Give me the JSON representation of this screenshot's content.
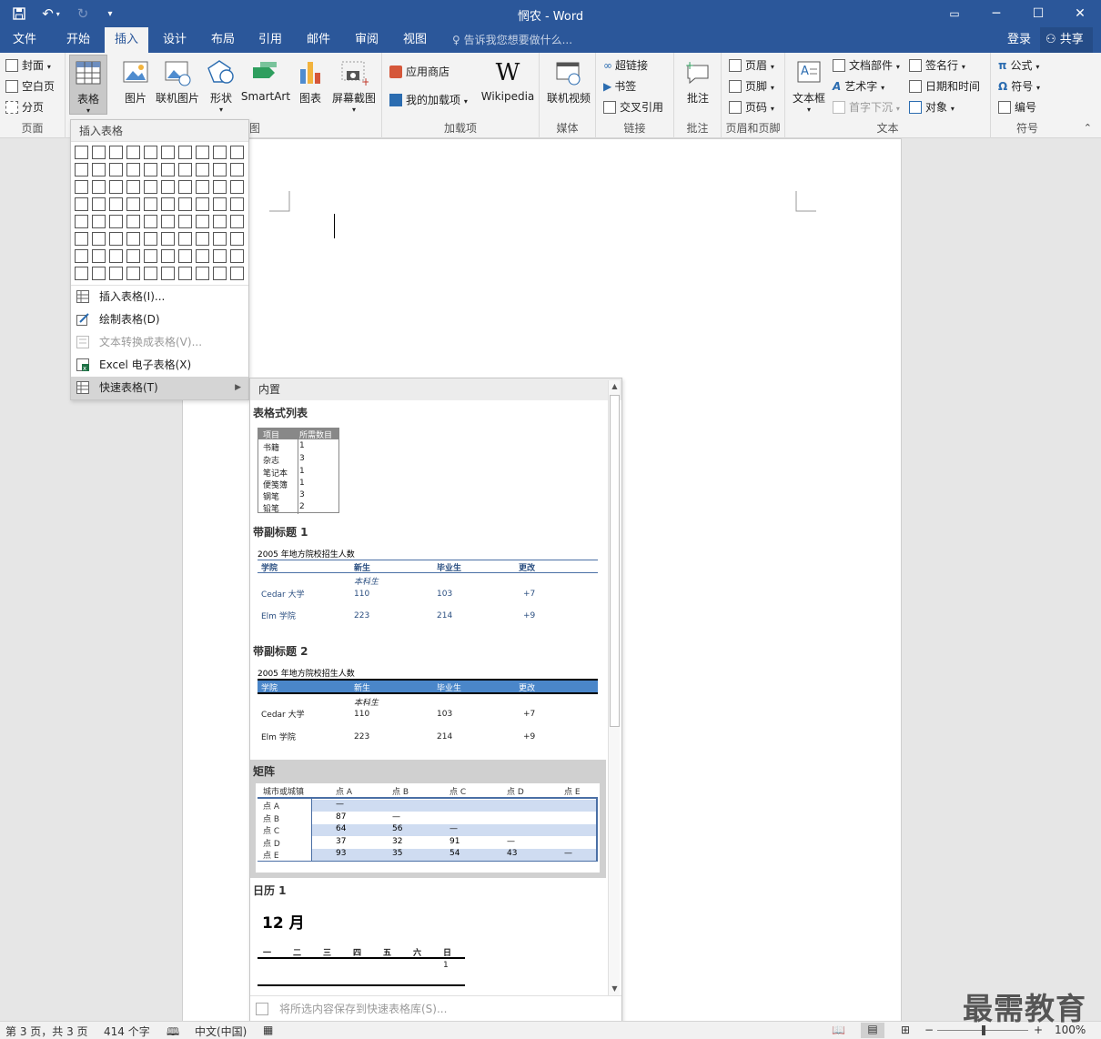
{
  "app": {
    "title": "惘农 - Word"
  },
  "window_controls": {
    "restore_ribbon": "▭",
    "minimize": "─",
    "maximize": "☐",
    "close": "✕"
  },
  "tabs": [
    {
      "label": "文件"
    },
    {
      "label": "开始"
    },
    {
      "label": "插入"
    },
    {
      "label": "设计"
    },
    {
      "label": "布局"
    },
    {
      "label": "引用"
    },
    {
      "label": "邮件"
    },
    {
      "label": "审阅"
    },
    {
      "label": "视图"
    }
  ],
  "tellme": "♀ 告诉我您想要做什么...",
  "account": {
    "login": "登录",
    "share": "共享"
  },
  "ribbon": {
    "pages": {
      "label": "页面",
      "cover": "封面",
      "blank": "空白页",
      "break": "分页"
    },
    "tables": {
      "label": "表格"
    },
    "illustrations": {
      "label": "图",
      "picture": "图片",
      "online_picture": "联机图片",
      "shapes": "形状",
      "smartart": "SmartArt",
      "chart": "图表",
      "screenshot": "屏幕截图"
    },
    "addins": {
      "label": "加载项",
      "store": "应用商店",
      "my_addins": "我的加载项",
      "wikipedia": "Wikipedia"
    },
    "media": {
      "label": "媒体",
      "video": "联机视频"
    },
    "links": {
      "label": "链接",
      "hyperlink": "超链接",
      "bookmark": "书签",
      "crossref": "交叉引用"
    },
    "comments": {
      "label": "批注",
      "comment": "批注"
    },
    "header_footer": {
      "label": "页眉和页脚",
      "header": "页眉",
      "footer": "页脚",
      "page_number": "页码"
    },
    "text": {
      "label": "文本",
      "textbox": "文本框",
      "quickparts": "文档部件",
      "wordart": "艺术字",
      "dropcap": "首字下沉",
      "signature": "签名行",
      "datetime": "日期和时间",
      "object": "对象"
    },
    "symbols": {
      "label": "符号",
      "equation": "公式",
      "symbol": "符号",
      "numbering": "编号"
    }
  },
  "table_menu": {
    "header": "插入表格",
    "items": [
      {
        "label": "插入表格(I)...",
        "disabled": false
      },
      {
        "label": "绘制表格(D)",
        "disabled": false
      },
      {
        "label": "文本转换成表格(V)...",
        "disabled": true
      },
      {
        "label": "Excel 电子表格(X)",
        "disabled": false
      },
      {
        "label": "快速表格(T)",
        "disabled": false
      }
    ]
  },
  "quick_tables": {
    "header": "内置",
    "footer": "将所选内容保存到快速表格库(S)...",
    "items": [
      {
        "title": "表格式列表",
        "head": [
          "项目",
          "所需数目"
        ],
        "rows": [
          [
            "书籍",
            "1"
          ],
          [
            "杂志",
            "3"
          ],
          [
            "笔记本",
            "1"
          ],
          [
            "便笺簿",
            "1"
          ],
          [
            "钢笔",
            "3"
          ],
          [
            "铅笔",
            "2"
          ]
        ]
      },
      {
        "title": "带副标题 1",
        "caption": "2005 年地方院校招生人数",
        "head": [
          "学院",
          "新生",
          "毕业生",
          "更改"
        ],
        "subhead": "本科生",
        "rows": [
          [
            "Cedar 大学",
            "110",
            "103",
            "+7"
          ],
          [
            "Elm 学院",
            "223",
            "214",
            "+9"
          ]
        ]
      },
      {
        "title": "带副标题 2",
        "caption": "2005 年地方院校招生人数",
        "head": [
          "学院",
          "新生",
          "毕业生",
          "更改"
        ],
        "subhead": "本科生",
        "rows": [
          [
            "Cedar 大学",
            "110",
            "103",
            "+7"
          ],
          [
            "Elm 学院",
            "223",
            "214",
            "+9"
          ]
        ]
      },
      {
        "title": "矩阵",
        "head": [
          "城市或城镇",
          "点 A",
          "点 B",
          "点 C",
          "点 D",
          "点 E"
        ],
        "rows": [
          [
            "点 A",
            "—",
            "",
            "",
            "",
            ""
          ],
          [
            "点 B",
            "87",
            "—",
            "",
            "",
            ""
          ],
          [
            "点 C",
            "64",
            "56",
            "—",
            "",
            ""
          ],
          [
            "点 D",
            "37",
            "32",
            "91",
            "—",
            ""
          ],
          [
            "点 E",
            "93",
            "35",
            "54",
            "43",
            "—"
          ]
        ]
      },
      {
        "title": "日历 1",
        "month": "12 月",
        "days": [
          "一",
          "二",
          "三",
          "四",
          "五",
          "六",
          "日"
        ],
        "first_day": "1"
      }
    ]
  },
  "status": {
    "page": "第 3 页，共 3 页",
    "words": "414 个字",
    "lang": "中文(中国)",
    "zoom": "100%"
  },
  "watermark": "最需教育"
}
